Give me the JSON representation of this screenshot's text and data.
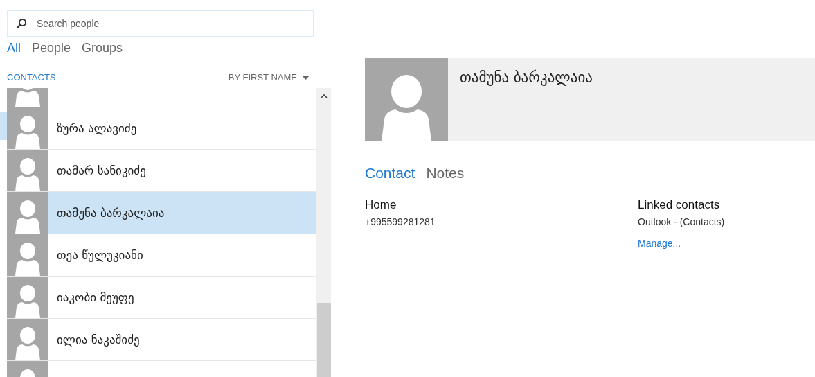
{
  "search": {
    "placeholder": "Search people"
  },
  "filters": [
    {
      "label": "All",
      "selected": true
    },
    {
      "label": "People",
      "selected": false
    },
    {
      "label": "Groups",
      "selected": false
    }
  ],
  "list_header": {
    "section": "CONTACTS",
    "sort": "BY FIRST NAME"
  },
  "contacts": [
    {
      "selected": false
    },
    {
      "name": "ზურა ალავიძე",
      "selected": false
    },
    {
      "name": "თამარ სანიკიძე",
      "selected": false
    },
    {
      "name": "თამუნა ბარკალაია",
      "selected": true
    },
    {
      "name": "თეა წულუკიანი",
      "selected": false
    },
    {
      "name": "იაკობი მეუფე",
      "selected": false
    },
    {
      "name": "ილია ნაკაშიძე",
      "selected": false
    },
    {
      "selected": false
    }
  ],
  "detail": {
    "name": "თამუნა ბარკალაია",
    "tabs": [
      {
        "label": "Contact",
        "selected": true
      },
      {
        "label": "Notes",
        "selected": false
      }
    ],
    "phone": {
      "label": "Home",
      "value": "+995599281281"
    },
    "linked": {
      "label": "Linked contacts",
      "source": "Outlook - (Contacts)",
      "link": "Manage..."
    }
  }
}
